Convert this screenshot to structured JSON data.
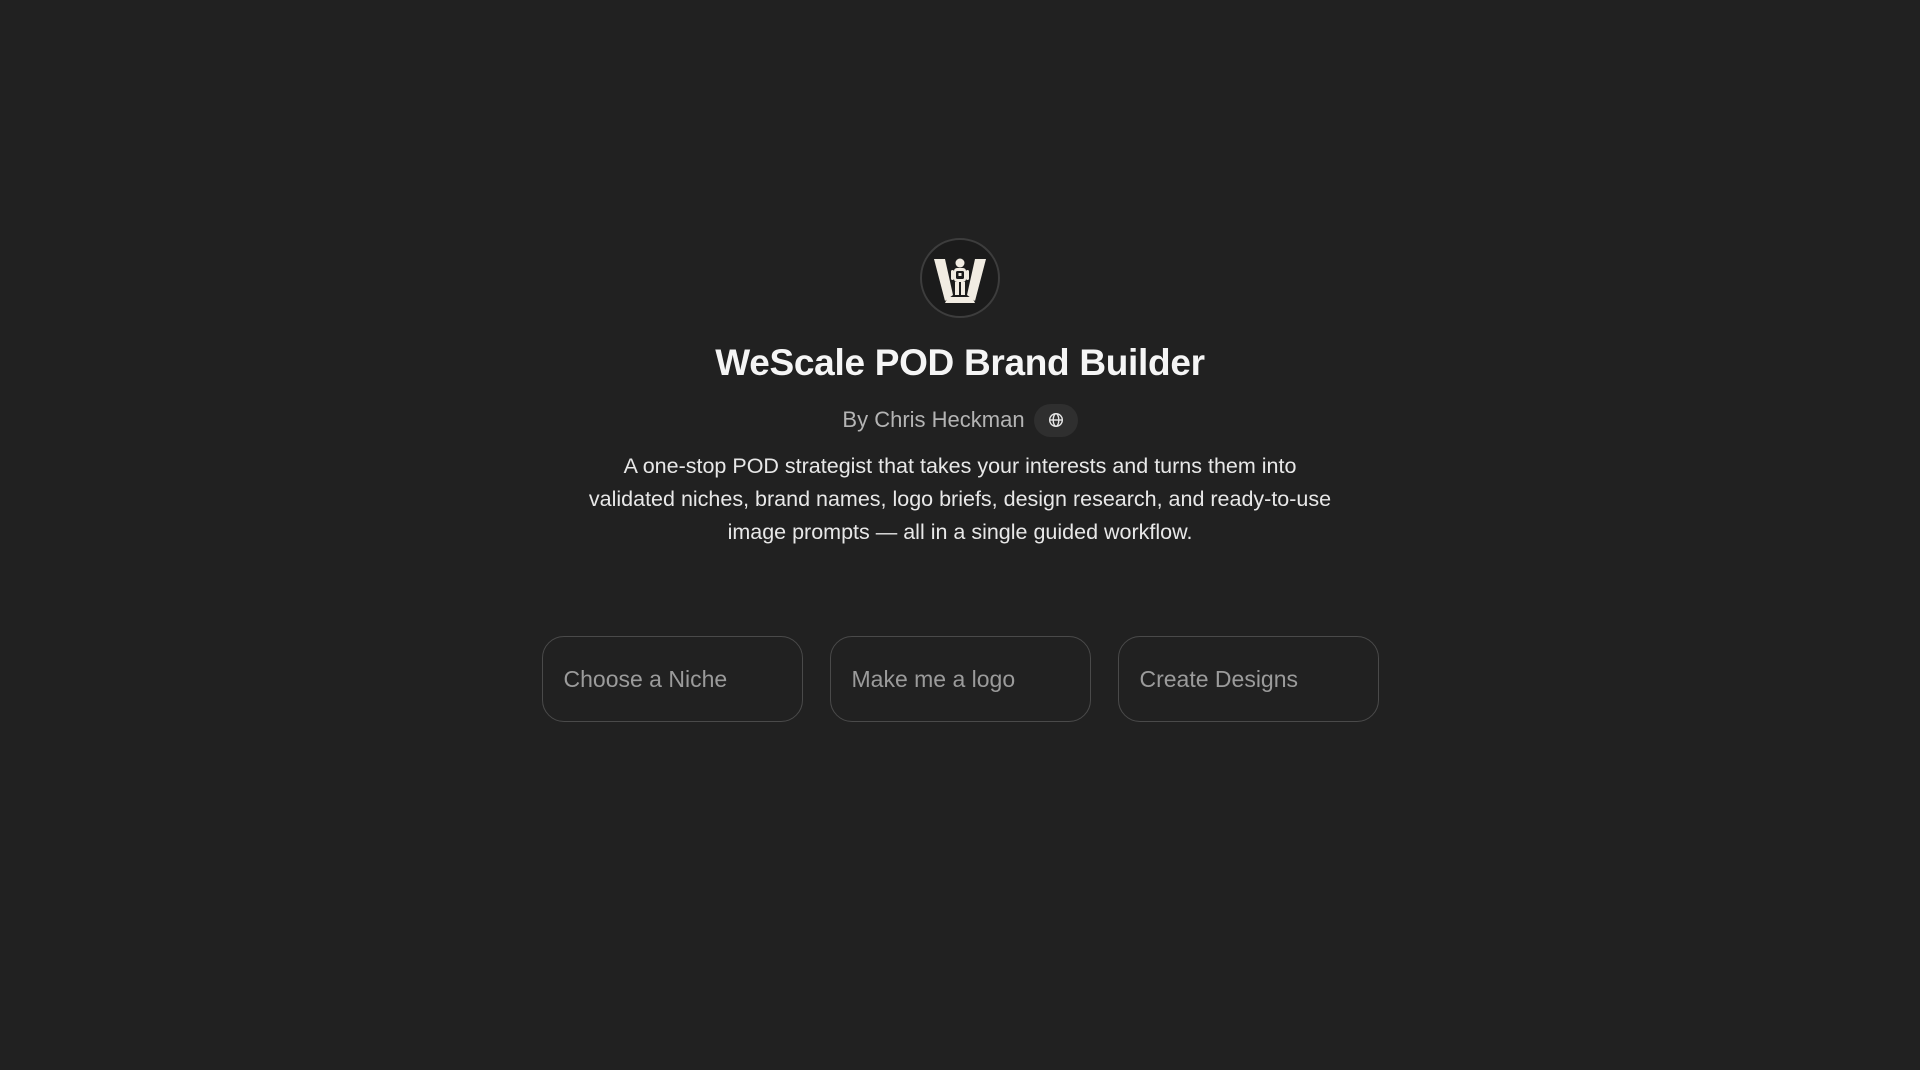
{
  "gpt": {
    "avatar_icon": "wescale-logo-icon",
    "title": "WeScale POD Brand Builder",
    "author": "By Chris Heckman",
    "author_link_icon": "globe-icon",
    "description": "A one-stop POD strategist that takes your interests and turns them into validated niches, brand names, logo briefs, design research, and ready-to-use image prompts — all in a single guided workflow."
  },
  "conversation_starters": [
    {
      "label": "Choose a Niche"
    },
    {
      "label": "Make me a logo"
    },
    {
      "label": "Create Designs"
    }
  ],
  "colors": {
    "background": "#212121",
    "title": "#f5f5f5",
    "muted_text": "#b4b4b4",
    "starter_border": "#4a4a4a",
    "starter_text": "#9b9b9b",
    "logo_cream": "#f1ece2"
  }
}
